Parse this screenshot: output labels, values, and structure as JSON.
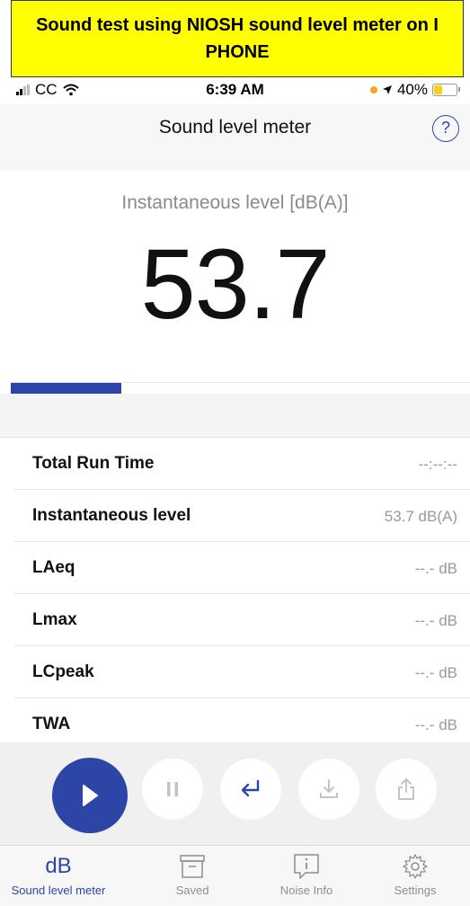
{
  "banner": {
    "text": "Sound test using NIOSH sound level meter on I PHONE"
  },
  "status": {
    "carrier": "CC",
    "time": "6:39 AM",
    "battery": "40%",
    "battery_level": 0.4
  },
  "nav": {
    "title": "Sound level meter",
    "help": "?"
  },
  "meter": {
    "label": "Instantaneous level [dB(A)]",
    "value": "53.7",
    "level_fraction": 0.24
  },
  "metrics": [
    {
      "label": "Total Run Time",
      "value": "--:--:--"
    },
    {
      "label": "Instantaneous level",
      "value": "53.7 dB(A)"
    },
    {
      "label": "LAeq",
      "value": "--.- dB"
    },
    {
      "label": "Lmax",
      "value": "--.- dB"
    },
    {
      "label": "LCpeak",
      "value": "--.- dB"
    },
    {
      "label": "TWA",
      "value": "--.- dB"
    }
  ],
  "controls": [
    "play-icon",
    "pause-icon",
    "return-icon",
    "download-icon",
    "share-icon"
  ],
  "tabs": [
    {
      "label": "Sound level meter",
      "icon": "dB"
    },
    {
      "label": "Saved",
      "icon": "archive-icon"
    },
    {
      "label": "Noise Info",
      "icon": "info-icon"
    },
    {
      "label": "Settings",
      "icon": "gear-icon"
    }
  ],
  "colors": {
    "accent": "#2e45a8",
    "banner": "#ffff00",
    "inactive": "#c4c4c4"
  }
}
